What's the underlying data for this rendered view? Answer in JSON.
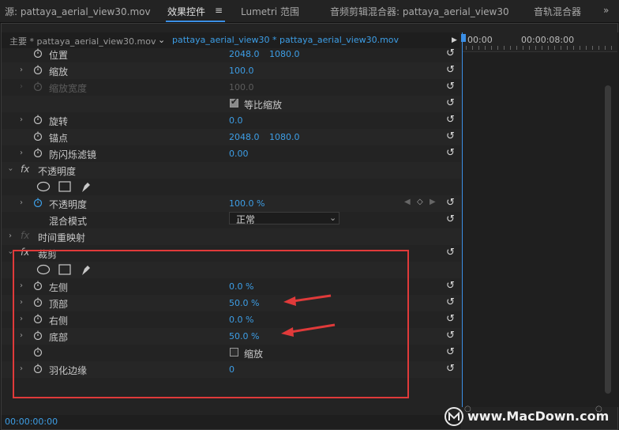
{
  "tabs": {
    "source": "源: pattaya_aerial_view30.mov",
    "effect_controls": "效果控件",
    "lumetri": "Lumetri 范围",
    "audio_clip_mixer": "音频剪辑混合器: pattaya_aerial_view30",
    "track_mixer": "音轨混合器",
    "overflow": "»"
  },
  "breadcrumb": {
    "master": "主要 * pattaya_aerial_view30.mov",
    "clip": "pattaya_aerial_view30 * pattaya_aerial_view30.mov"
  },
  "timeline": {
    "t0": "00:00",
    "t1": "00:00:08:00"
  },
  "motion": {
    "position": {
      "label": "位置",
      "x": "2048.0",
      "y": "1080.0"
    },
    "scale": {
      "label": "缩放",
      "value": "100.0"
    },
    "scale_width": {
      "label": "缩放宽度",
      "value": "100.0"
    },
    "uniform_scale": "等比缩放",
    "rotation": {
      "label": "旋转",
      "value": "0.0"
    },
    "anchor": {
      "label": "锚点",
      "x": "2048.0",
      "y": "1080.0"
    },
    "anti_flicker": {
      "label": "防闪烁滤镜",
      "value": "0.00"
    }
  },
  "opacity": {
    "fx": "fx",
    "title": "不透明度",
    "label": "不透明度",
    "value": "100.0 %",
    "blend_label": "混合模式",
    "blend_value": "正常"
  },
  "time_remap": {
    "fx": "fx",
    "title": "时间重映射"
  },
  "crop": {
    "fx": "fx",
    "title": "裁剪",
    "left": {
      "label": "左侧",
      "value": "0.0 %"
    },
    "top": {
      "label": "顶部",
      "value": "50.0 %"
    },
    "right": {
      "label": "右侧",
      "value": "0.0 %"
    },
    "bottom": {
      "label": "底部",
      "value": "50.0 %"
    },
    "zoom": "缩放",
    "feather": {
      "label": "羽化边缘",
      "value": "0"
    }
  },
  "footer": {
    "timecode": "00:00:00:00"
  },
  "watermark": "www.MacDown.com",
  "colors": {
    "accent": "#3d9ee6",
    "highlight": "#e03a3a"
  }
}
